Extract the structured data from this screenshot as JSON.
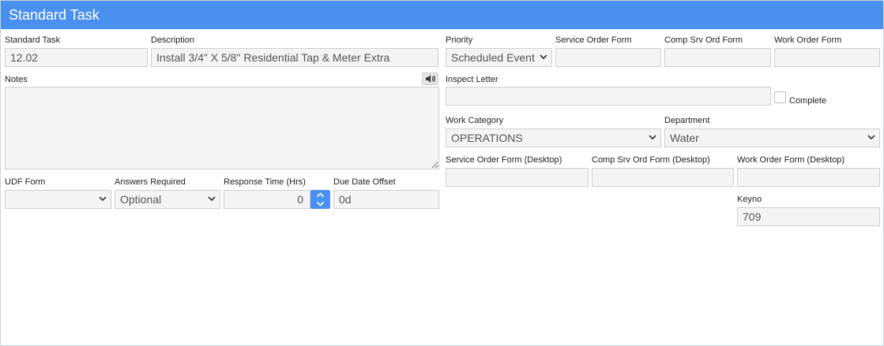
{
  "window": {
    "title": "Standard Task"
  },
  "form": {
    "standard_task": {
      "label": "Standard Task",
      "value": "12.02"
    },
    "description": {
      "label": "Description",
      "value": "Install 3/4\" X 5/8\" Residential Tap & Meter Extra"
    },
    "notes": {
      "label": "Notes",
      "value": ""
    },
    "udf_form": {
      "label": "UDF Form",
      "value": ""
    },
    "answers_required": {
      "label": "Answers Required",
      "value": "Optional"
    },
    "response_time": {
      "label": "Response Time (Hrs)",
      "value": "0"
    },
    "due_date_offset": {
      "label": "Due Date Offset",
      "value": "0d"
    },
    "priority": {
      "label": "Priority",
      "value": "Scheduled Event"
    },
    "service_order_form": {
      "label": "Service Order Form",
      "value": ""
    },
    "comp_srv_ord_form": {
      "label": "Comp Srv Ord Form",
      "value": ""
    },
    "work_order_form": {
      "label": "Work Order Form",
      "value": ""
    },
    "inspect_letter": {
      "label": "Inspect Letter",
      "value": ""
    },
    "complete": {
      "label": "Complete",
      "checked": false
    },
    "work_category": {
      "label": "Work Category",
      "value": "OPERATIONS"
    },
    "department": {
      "label": "Department",
      "value": "Water"
    },
    "service_order_form_desktop": {
      "label": "Service Order Form (Desktop)",
      "value": ""
    },
    "comp_srv_ord_form_desktop": {
      "label": "Comp Srv Ord Form (Desktop)",
      "value": ""
    },
    "work_order_form_desktop": {
      "label": "Work Order Form (Desktop)",
      "value": ""
    },
    "keyno": {
      "label": "Keyno",
      "value": "709"
    }
  },
  "icons": {
    "speaker": "speaker-icon",
    "select_arrow": "chevron-down-icon",
    "spin_up": "chevron-up-icon",
    "spin_down": "chevron-down-icon"
  },
  "colors": {
    "accent": "#4a90f0",
    "field_bg": "#f4f4f4",
    "border": "#cfcfcf"
  }
}
